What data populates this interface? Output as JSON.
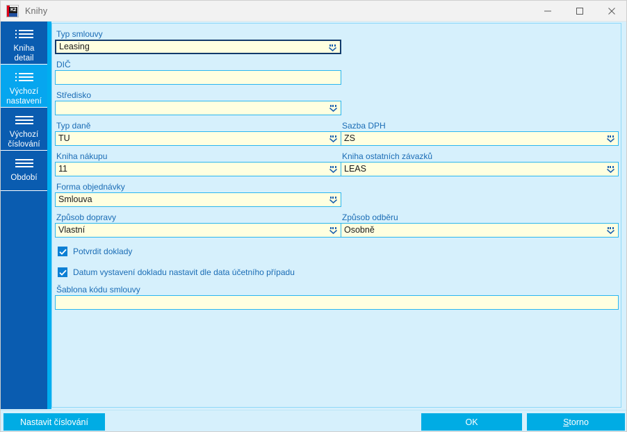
{
  "window": {
    "title": "Knihy",
    "app_icon": "k2-logo-icon",
    "controls": {
      "minimize": "minimize-icon",
      "maximize": "maximize-icon",
      "close": "close-icon"
    }
  },
  "sidebar": {
    "items": [
      {
        "label": "Kniha\ndetail",
        "icon": "list-icon",
        "active": false
      },
      {
        "label": "Výchozí\nnastavení",
        "icon": "list-icon",
        "active": true
      },
      {
        "label": "Výchozí\nčíslování",
        "icon": "menu-icon",
        "active": false
      },
      {
        "label": "Období",
        "icon": "menu-icon",
        "active": false
      }
    ]
  },
  "form": {
    "fields": [
      {
        "label": "Typ smlouvy",
        "value": "Leasing",
        "dropdown": true,
        "focused": true
      },
      {
        "label": "DIČ",
        "value": "",
        "dropdown": false,
        "focused": false
      },
      {
        "label": "Středisko",
        "value": "",
        "dropdown": true,
        "focused": false
      },
      {
        "label": "Typ daně",
        "value": "TU",
        "dropdown": true,
        "focused": false
      },
      {
        "label": "Sazba DPH",
        "value": "ZS",
        "dropdown": true,
        "focused": false
      },
      {
        "label": "Kniha nákupu",
        "value": "11",
        "dropdown": true,
        "focused": false
      },
      {
        "label": "Kniha ostatních závazků",
        "value": "LEAS",
        "dropdown": true,
        "focused": false
      },
      {
        "label": "Forma objednávky",
        "value": "Smlouva",
        "dropdown": true,
        "focused": false
      },
      {
        "label": "Způsob dopravy",
        "value": "Vlastní",
        "dropdown": true,
        "focused": false
      },
      {
        "label": "Způsob odběru",
        "value": "Osobně",
        "dropdown": true,
        "focused": false
      },
      {
        "label": "Šablona kódu smlouvy",
        "value": "",
        "dropdown": false,
        "focused": false
      }
    ],
    "checkboxes": [
      {
        "label": "Potvrdit doklady",
        "checked": true
      },
      {
        "label": "Datum vystavení dokladu nastavit dle data účetního případu",
        "checked": true
      }
    ]
  },
  "footer": {
    "numbering_button": "Nastavit číslování",
    "ok_button": "OK",
    "cancel_button_prefix": "",
    "cancel_button_accel": "S",
    "cancel_button_rest": "torno"
  },
  "colors": {
    "sidebar": "#0a5cb0",
    "sidebar_active": "#06a6ef",
    "accent": "#00aeef",
    "panel_bg": "#d6f0fc",
    "field_bg": "#ffffe0",
    "field_border": "#29b6f0",
    "field_focus_border": "#123a6b",
    "label_text": "#1a6cb5",
    "button_bg": "#00ace4"
  }
}
